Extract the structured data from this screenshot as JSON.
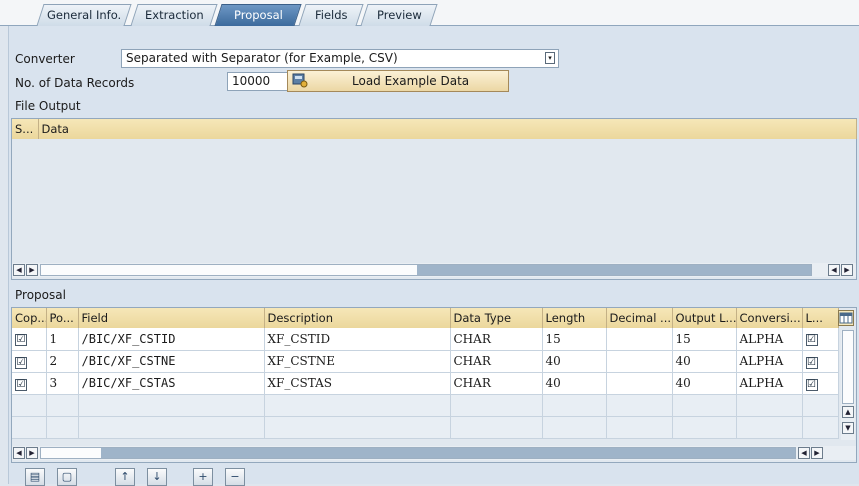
{
  "tabs": [
    {
      "label": "General Info.",
      "active": false
    },
    {
      "label": "Extraction",
      "active": false
    },
    {
      "label": "Proposal",
      "active": true
    },
    {
      "label": "Fields",
      "active": false
    },
    {
      "label": "Preview",
      "active": false
    }
  ],
  "converter": {
    "label": "Converter",
    "value": "Separated with Separator (for Example, CSV)"
  },
  "records": {
    "label": "No. of Data Records",
    "value": "10000"
  },
  "load_button": {
    "label": "Load Example Data"
  },
  "file_output": {
    "title": "File Output",
    "columns": [
      "S...",
      "Data"
    ]
  },
  "proposal": {
    "title": "Proposal",
    "columns": [
      "Cop...",
      "Po...",
      "Field",
      "Description",
      "Data Type",
      "Length",
      "Decimal ...",
      "Output L...",
      "Conversi...",
      "L..."
    ],
    "rows": [
      {
        "copy": "☑",
        "pos": "1",
        "field": "/BIC/XF_CSTID",
        "description": "XF_CSTID",
        "data_type": "CHAR",
        "length": "15",
        "decimal": "",
        "output_len": "15",
        "conversion": "ALPHA",
        "l": "☑"
      },
      {
        "copy": "☑",
        "pos": "2",
        "field": "/BIC/XF_CSTNE",
        "description": "XF_CSTNE",
        "data_type": "CHAR",
        "length": "40",
        "decimal": "",
        "output_len": "40",
        "conversion": "ALPHA",
        "l": "☑"
      },
      {
        "copy": "☑",
        "pos": "3",
        "field": "/BIC/XF_CSTAS",
        "description": "XF_CSTAS",
        "data_type": "CHAR",
        "length": "40",
        "decimal": "",
        "output_len": "40",
        "conversion": "ALPHA",
        "l": "☑"
      }
    ]
  },
  "toolbar_icons": [
    "select-all-icon",
    "deselect-all-icon",
    "move-up-icon",
    "move-down-icon",
    "insert-icon",
    "delete-icon"
  ],
  "colors": {
    "active_tab": "#4f7fb1",
    "header_yellow": "#ecd9a0",
    "background": "#d9e3ee"
  }
}
